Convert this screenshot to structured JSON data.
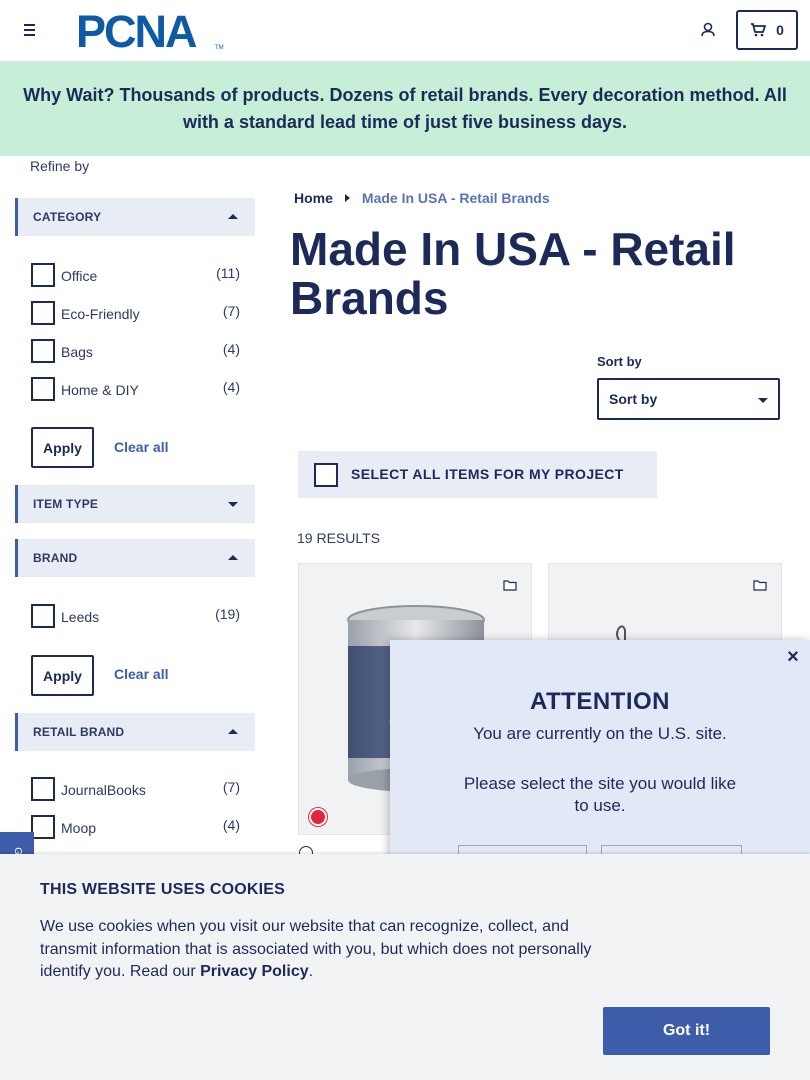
{
  "header": {
    "logo_text": "PCNA",
    "cart_count": "0"
  },
  "banner": {
    "text": "Why Wait? Thousands of products. Dozens of retail brands. Every decoration method. All with a standard lead time of just five business days."
  },
  "sidebar": {
    "refine_label": "Refine by",
    "side_tab_label": "GI",
    "facets": {
      "category": {
        "title": "CATEGORY",
        "options": [
          {
            "label": "Office",
            "count": "(11)"
          },
          {
            "label": "Eco-Friendly",
            "count": "(7)"
          },
          {
            "label": "Bags",
            "count": "(4)"
          },
          {
            "label": "Home & DIY",
            "count": "(4)"
          }
        ],
        "apply_label": "Apply",
        "clear_label": "Clear all"
      },
      "item_type": {
        "title": "ITEM TYPE"
      },
      "brand": {
        "title": "BRAND",
        "options": [
          {
            "label": "Leeds",
            "count": "(19)"
          }
        ],
        "apply_label": "Apply",
        "clear_label": "Clear all"
      },
      "retail_brand": {
        "title": "RETAIL BRAND",
        "options": [
          {
            "label": "JournalBooks",
            "count": "(7)"
          },
          {
            "label": "Moop",
            "count": "(4)"
          }
        ]
      }
    }
  },
  "main": {
    "breadcrumb": {
      "home": "Home",
      "current": "Made In USA - Retail Brands"
    },
    "title": "Made In USA - Retail Brands",
    "sort": {
      "label": "Sort by",
      "selected": "Sort by"
    },
    "select_all_label": "SELECT ALL ITEMS FOR MY PROJECT",
    "results_label": "19 RESULTS",
    "swatch_color": "#e2263a"
  },
  "modal": {
    "title": "ATTENTION",
    "subtitle": "You are currently on the U.S. site.",
    "message": "Please select the site you would like to use.",
    "close_label": "×"
  },
  "cookie": {
    "title": "THIS WEBSITE USES COOKIES",
    "text_before": "We use cookies when you visit our website that can recognize, collect, and transmit information that is associated with you, but which does not personally identify you. Read our ",
    "link_label": "Privacy Policy",
    "text_after": ".",
    "button_label": "Got it!"
  },
  "colors": {
    "navy": "#1c2a5a",
    "accent_blue": "#3d5caa",
    "banner_green": "#c7eed6"
  }
}
